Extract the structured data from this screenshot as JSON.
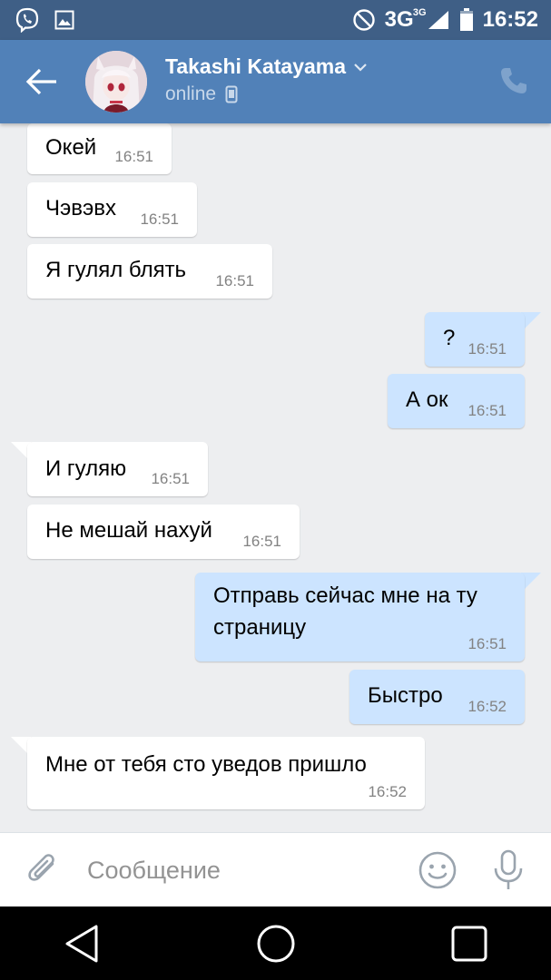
{
  "status_bar": {
    "network": "3G",
    "network_sup": "3G",
    "time": "16:52",
    "icons": [
      "viber-icon",
      "gallery-icon",
      "do-not-disturb-icon",
      "signal-icon",
      "battery-icon"
    ]
  },
  "header": {
    "contact_name": "Takashi Katayama",
    "presence": "online",
    "icons": [
      "back-arrow-icon",
      "chevron-down-icon",
      "mobile-icon",
      "phone-icon"
    ],
    "accent_color": "#5181b8"
  },
  "messages": [
    {
      "direction": "in",
      "text": "Окей",
      "time": "16:51"
    },
    {
      "direction": "in",
      "text": "Чэвэвх",
      "time": "16:51"
    },
    {
      "direction": "in",
      "text": "Я гулял блять",
      "time": "16:51"
    },
    {
      "direction": "out",
      "text": "?",
      "time": "16:51"
    },
    {
      "direction": "out",
      "text": "А ок",
      "time": "16:51"
    },
    {
      "direction": "in",
      "text": "И гуляю",
      "time": "16:51"
    },
    {
      "direction": "in",
      "text": "Не мешай нахуй",
      "time": "16:51"
    },
    {
      "direction": "out",
      "text_line1": "Отправь сейчас мне на ту",
      "text_line2": "страницу",
      "time": "16:51"
    },
    {
      "direction": "out",
      "text": "Быстро",
      "time": "16:52"
    },
    {
      "direction": "in",
      "text": "Мне от тебя сто уведов пришло",
      "time": "16:52"
    }
  ],
  "composer": {
    "placeholder": "Сообщение",
    "icons": [
      "paperclip-icon",
      "smile-icon",
      "microphone-icon"
    ]
  },
  "colors": {
    "incoming_bubble": "#ffffff",
    "outgoing_bubble": "#cce4ff",
    "chat_background": "#edeef0",
    "status_bar": "#3f5f86"
  }
}
